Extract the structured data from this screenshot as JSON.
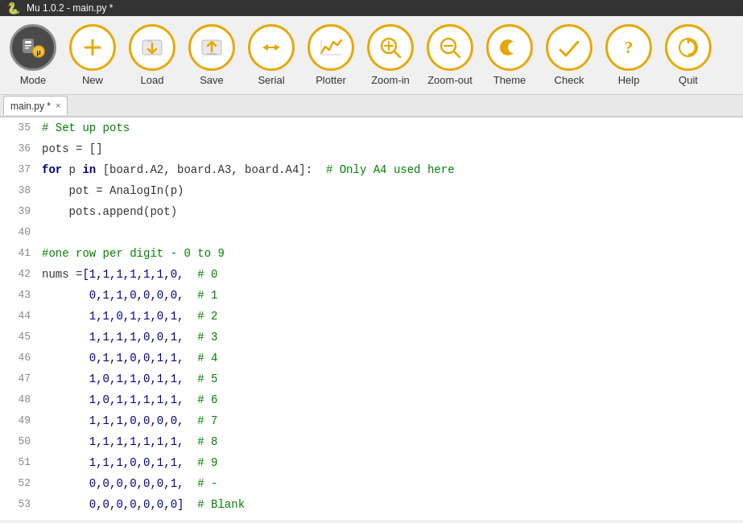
{
  "window_title": "Mu 1.0.2 - main.py *",
  "toolbar": {
    "buttons": [
      {
        "id": "mode",
        "label": "Mode",
        "icon": "mode"
      },
      {
        "id": "new",
        "label": "New",
        "icon": "new"
      },
      {
        "id": "load",
        "label": "Load",
        "icon": "load"
      },
      {
        "id": "save",
        "label": "Save",
        "icon": "save"
      },
      {
        "id": "serial",
        "label": "Serial",
        "icon": "serial"
      },
      {
        "id": "plotter",
        "label": "Plotter",
        "icon": "plotter"
      },
      {
        "id": "zoom-in",
        "label": "Zoom-in",
        "icon": "zoom-in"
      },
      {
        "id": "zoom-out",
        "label": "Zoom-out",
        "icon": "zoom-out"
      },
      {
        "id": "theme",
        "label": "Theme",
        "icon": "theme"
      },
      {
        "id": "check",
        "label": "Check",
        "icon": "check"
      },
      {
        "id": "help",
        "label": "Help",
        "icon": "help"
      },
      {
        "id": "quit",
        "label": "Quit",
        "icon": "quit"
      }
    ]
  },
  "tab": {
    "name": "main.py *",
    "close_label": "×"
  },
  "code_lines": [
    {
      "num": 35,
      "content": "# Set up pots",
      "type": "comment"
    },
    {
      "num": 36,
      "content": "pots = []",
      "type": "normal"
    },
    {
      "num": 37,
      "content": "for p in [board.A2, board.A3, board.A4]:  # Only A4 used here",
      "type": "for_line"
    },
    {
      "num": 38,
      "content": "    pot = AnalogIn(p)",
      "type": "normal"
    },
    {
      "num": 39,
      "content": "    pots.append(pot)",
      "type": "normal"
    },
    {
      "num": 40,
      "content": "",
      "type": "blank"
    },
    {
      "num": 41,
      "content": "#one row per digit - 0 to 9",
      "type": "comment"
    },
    {
      "num": 42,
      "content": "nums =[1,1,1,1,1,1,0,  # 0",
      "type": "data"
    },
    {
      "num": 43,
      "content": "       0,1,1,0,0,0,0,  # 1",
      "type": "data"
    },
    {
      "num": 44,
      "content": "       1,1,0,1,1,0,1,  # 2",
      "type": "data"
    },
    {
      "num": 45,
      "content": "       1,1,1,1,0,0,1,  # 3",
      "type": "data"
    },
    {
      "num": 46,
      "content": "       0,1,1,0,0,1,1,  # 4",
      "type": "data"
    },
    {
      "num": 47,
      "content": "       1,0,1,1,0,1,1,  # 5",
      "type": "data"
    },
    {
      "num": 48,
      "content": "       1,0,1,1,1,1,1,  # 6",
      "type": "data"
    },
    {
      "num": 49,
      "content": "       1,1,1,0,0,0,0,  # 7",
      "type": "data"
    },
    {
      "num": 50,
      "content": "       1,1,1,1,1,1,1,  # 8",
      "type": "data"
    },
    {
      "num": 51,
      "content": "       1,1,1,0,0,1,1,  # 9",
      "type": "data"
    },
    {
      "num": 52,
      "content": "       0,0,0,0,0,0,1,  # -",
      "type": "data"
    },
    {
      "num": 53,
      "content": "       0,0,0,0,0,0,0]  # Blank",
      "type": "data"
    }
  ]
}
